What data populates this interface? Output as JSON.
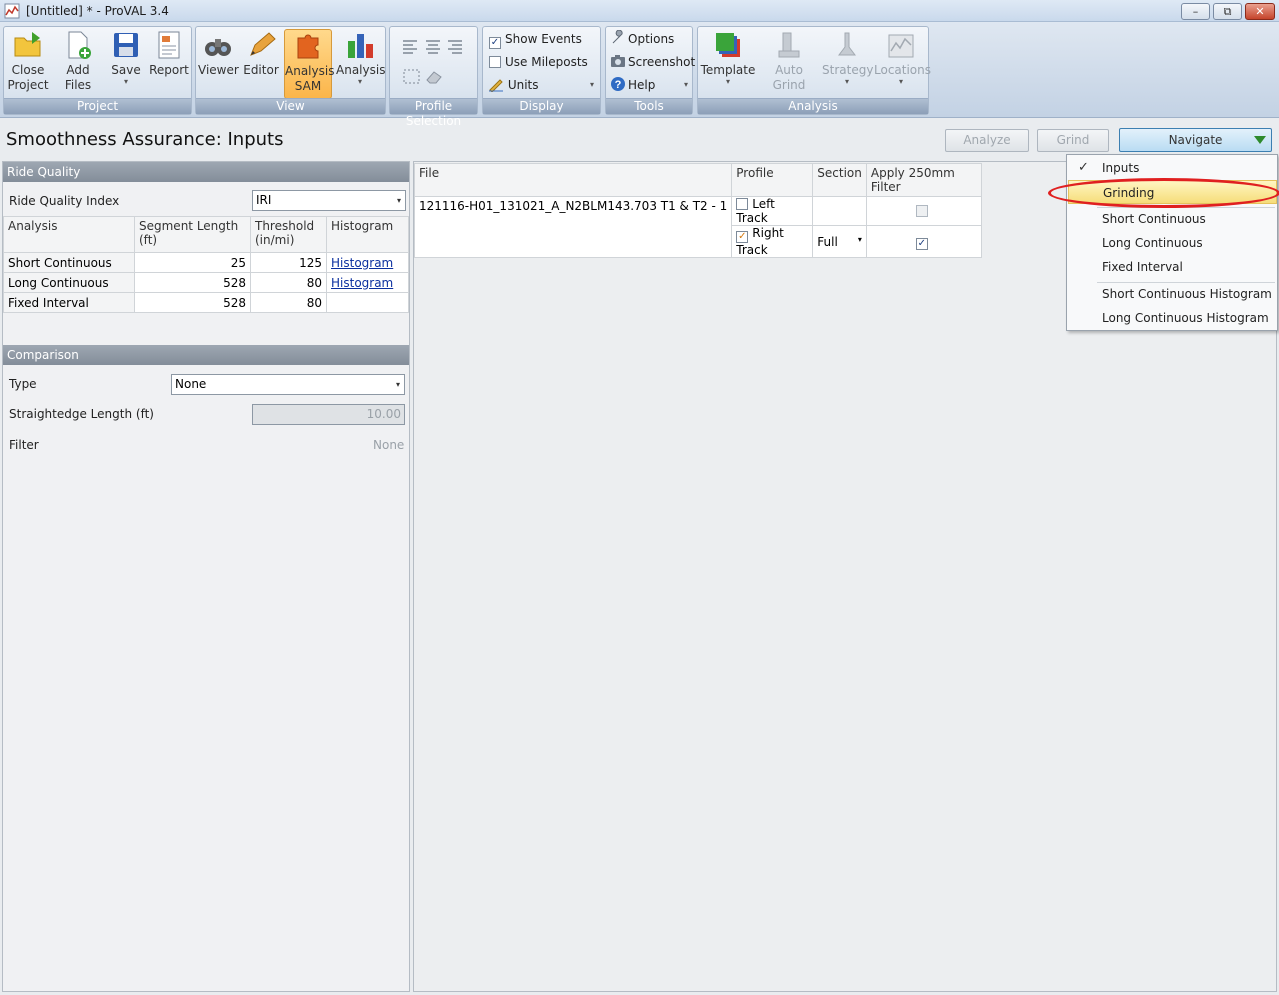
{
  "window": {
    "title": "[Untitled] * - ProVAL 3.4",
    "min_label": "–",
    "max_label": "⧉",
    "close_label": "✕"
  },
  "ribbon": {
    "project": {
      "label": "Project",
      "close_project": "Close\nProject",
      "add_files": "Add Files",
      "save": "Save",
      "report": "Report"
    },
    "view": {
      "label": "View",
      "viewer": "Viewer",
      "editor": "Editor",
      "analysis_sam": "Analysis\nSAM",
      "analysis": "Analysis"
    },
    "profile_selection": {
      "label": "Profile Selection"
    },
    "display": {
      "label": "Display",
      "show_events": "Show Events",
      "show_events_checked": true,
      "use_mileposts": "Use Mileposts",
      "use_mileposts_checked": false,
      "units": "Units"
    },
    "tools": {
      "label": "Tools",
      "options": "Options",
      "screenshot": "Screenshot",
      "help": "Help"
    },
    "analysis": {
      "label": "Analysis",
      "template": "Template",
      "auto_grind": "Auto Grind",
      "strategy": "Strategy",
      "locations": "Locations"
    }
  },
  "header": {
    "title": "Smoothness Assurance: Inputs",
    "analyze": "Analyze",
    "grind": "Grind",
    "navigate": "Navigate"
  },
  "ride_quality": {
    "section_title": "Ride Quality",
    "index_label": "Ride Quality Index",
    "index_value": "IRI",
    "columns": [
      "Analysis",
      "Segment Length\n(ft)",
      "Threshold\n(in/mi)",
      "Histogram"
    ],
    "rows": [
      {
        "analysis": "Short Continuous",
        "segment": "25",
        "threshold": "125",
        "histogram": "Histogram"
      },
      {
        "analysis": "Long Continuous",
        "segment": "528",
        "threshold": "80",
        "histogram": "Histogram"
      },
      {
        "analysis": "Fixed Interval",
        "segment": "528",
        "threshold": "80",
        "histogram": ""
      }
    ]
  },
  "comparison": {
    "section_title": "Comparison",
    "type_label": "Type",
    "type_value": "None",
    "straightedge_label": "Straightedge Length (ft)",
    "straightedge_value": "10.00",
    "filter_label": "Filter",
    "filter_value": "None"
  },
  "files": {
    "columns": [
      "File",
      "Profile",
      "Section",
      "Apply 250mm Filter"
    ],
    "file_name": "121116-H01_131021_A_N2BLM143.703 T1 & T2 - 1",
    "profiles": [
      {
        "name": "Left Track",
        "checked": false,
        "section": "",
        "filter": false
      },
      {
        "name": "Right Track",
        "checked": true,
        "section": "Full",
        "filter": true
      }
    ]
  },
  "navigate_menu": {
    "items": [
      "Inputs",
      "Grinding",
      "Short Continuous",
      "Long Continuous",
      "Fixed Interval",
      "Short Continuous Histogram",
      "Long Continuous Histogram"
    ],
    "checked_item": "Inputs",
    "highlighted_item": "Grinding",
    "annotation_color": "#e02020"
  },
  "colors": {
    "ribbon_active": "#fbb54a",
    "navigate_arrow": "#2d8a2d",
    "link": "#0b2f9f"
  }
}
